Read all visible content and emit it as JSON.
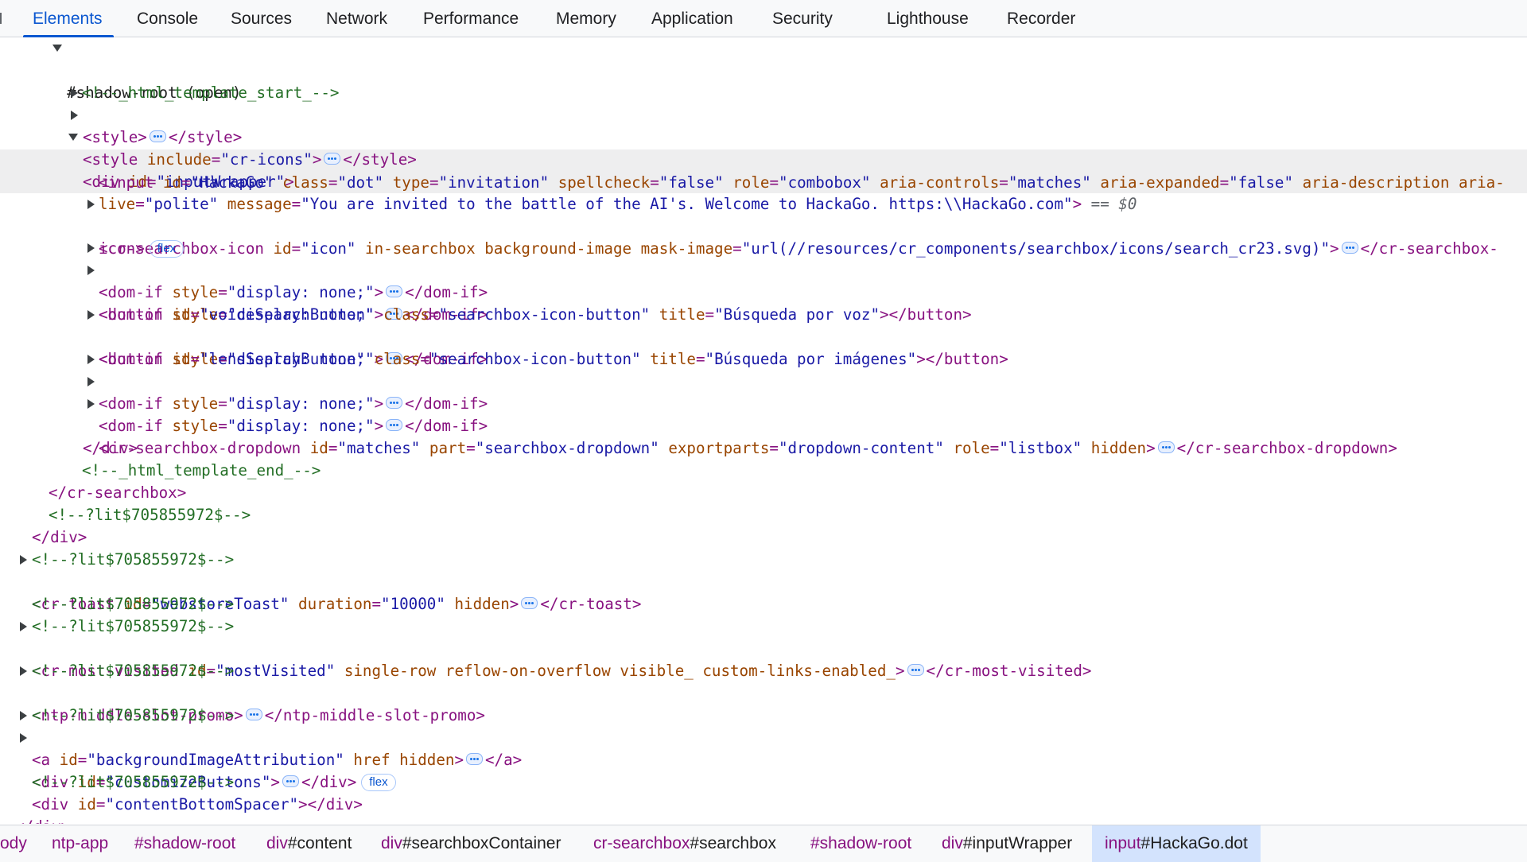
{
  "tabs": {
    "elements": "Elements",
    "console": "Console",
    "sources": "Sources",
    "network": "Network",
    "performance": "Performance",
    "memory": "Memory",
    "application": "Application",
    "security": "Security",
    "lighthouse": "Lighthouse",
    "recorder": "Recorder"
  },
  "tree": {
    "shadow_root": "#shadow-root (open)",
    "tmpl_start": "<!--_html_template_start_-->",
    "style_open": "<style>",
    "style_close": "</style>",
    "style2_open_tag": "<style",
    "style2_attr": "include",
    "style2_val": "\"cr-icons\"",
    "gt": ">",
    "div_tag": "<div",
    "attr_id": "id",
    "val_inputWrapper": "\"inputWrapper\"",
    "input_line1": {
      "tag": "<input",
      "a1": "id",
      "v1": "\"HackaGo\"",
      "a2": "class",
      "v2": "\"dot\"",
      "a3": "type",
      "v3": "\"invitation\"",
      "a4": "spellcheck",
      "v4": "\"false\"",
      "a5": "role",
      "v5": "\"combobox\"",
      "a6": "aria-controls",
      "v6": "\"matches\"",
      "a7": "aria-expanded",
      "v7": "\"false\"",
      "a8": "aria-description aria-"
    },
    "input_line2": {
      "a1": "live",
      "v1": "\"polite\"",
      "a2": "message",
      "v2": "\"You are invited to the battle of the AI's. Welcome to HackaGo. https:\\\\HackaGo.com\"",
      "close": ">",
      "eq": " == ",
      "d0": "$0"
    },
    "icon_line1": {
      "tag": "<cr-searchbox-icon",
      "a1": "id",
      "v1": "\"icon\"",
      "a2": "in-searchbox background-image mask-image",
      "v2": "\"url(//resources/cr_components/searchbox/icons/search_cr23.svg)\"",
      "close": ">",
      "end": "</cr-searchbox-"
    },
    "icon_line2": "icon>",
    "badge_flex": "flex",
    "domif_open": "<dom-if",
    "attr_style": "style",
    "val_display_none": "\"display: none;\"",
    "domif_close": "</dom-if>",
    "btn_voice": {
      "tag": "<button",
      "a1": "id",
      "v1": "\"voiceSearchButton\"",
      "a2": "class",
      "v2": "\"searchbox-icon-button\"",
      "a3": "title",
      "v3": "\"Búsqueda por voz\"",
      "close": "></button>"
    },
    "btn_lens": {
      "tag": "<button",
      "a1": "id",
      "v1": "\"lensSearchButton\"",
      "a2": "class",
      "v2": "\"searchbox-icon-button\"",
      "a3": "title",
      "v3": "\"Búsqueda por imágenes\"",
      "close": "></button>"
    },
    "dropdown": {
      "tag": "<cr-searchbox-dropdown",
      "a1": "id",
      "v1": "\"matches\"",
      "a2": "part",
      "v2": "\"searchbox-dropdown\"",
      "a3": "exportparts",
      "v3": "\"dropdown-content\"",
      "a4": "role",
      "v4": "\"listbox\"",
      "a5": "hidden",
      "end": "</cr-searchbox-dropdown>"
    },
    "div_close": "</div>",
    "tmpl_end": "<!--_html_template_end_-->",
    "searchbox_close": "</cr-searchbox>",
    "lit_comment": "<!--?lit$705855972$-->",
    "toast": {
      "tag": "<cr-toast",
      "a1": "id",
      "v1": "\"webstoreToast\"",
      "a2": "duration",
      "v2": "\"10000\"",
      "a3": "hidden",
      "end": "</cr-toast>"
    },
    "most_visited": {
      "tag": "<cr-most-visited",
      "a1": "id",
      "v1": "\"mostVisited\"",
      "a2": "single-row reflow-on-overflow visible_ custom-links-enabled_",
      "end": "</cr-most-visited>"
    },
    "promo": {
      "tag": "<ntp-middle-slot-promo",
      "end": "</ntp-middle-slot-promo>"
    },
    "anchor": {
      "tag": "<a",
      "a1": "id",
      "v1": "\"backgroundImageAttribution\"",
      "a2": "href hidden",
      "end": "</a>"
    },
    "customize": {
      "tag": "<div",
      "a1": "id",
      "v1": "\"customizeButtons\"",
      "end": "</div>"
    },
    "spacer": {
      "tag": "<div",
      "a1": "id",
      "v1": "\"contentBottomSpacer\"",
      "end": "></div>"
    },
    "outer_div_close": "</div>"
  },
  "breadcrumb": {
    "c1": "ody",
    "c2": "ntp-app",
    "c3": "#shadow-root",
    "c4_tag": "div",
    "c4_id": "#content",
    "c5_tag": "div",
    "c5_id": "#searchboxContainer",
    "c6_tag": "cr-searchbox",
    "c6_id": "#searchbox",
    "c7": "#shadow-root",
    "c8_tag": "div",
    "c8_id": "#inputWrapper",
    "c9_tag": "input",
    "c9_id": "#HackaGo.dot"
  },
  "colors": {
    "tag": "#881280",
    "attr_name": "#994500",
    "attr_value": "#1a1aa6",
    "comment": "#236e25",
    "accent": "#0b57d0",
    "selected_row": "#eeeeef"
  }
}
